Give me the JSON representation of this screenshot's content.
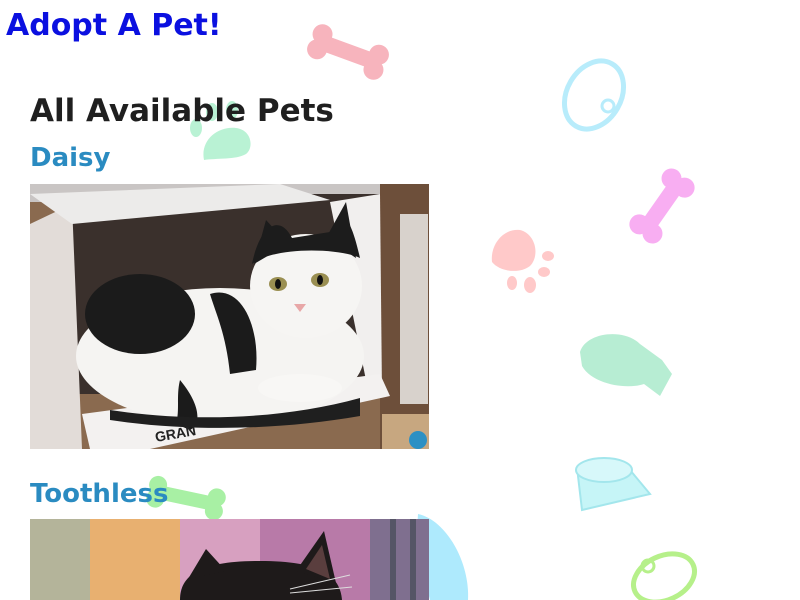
{
  "site": {
    "title": "Adopt A Pet!"
  },
  "main": {
    "heading": "All Available Pets"
  },
  "pets": [
    {
      "name": "Daisy"
    },
    {
      "name": "Toothless"
    }
  ],
  "colors": {
    "title": "#0b10e0",
    "heading": "#1f1f1f",
    "pet_name": "#2a8bc1"
  },
  "background_icons": [
    "bone-icon",
    "collar-icon",
    "paw-icon",
    "bone-icon",
    "paw-icon",
    "fish-icon",
    "bowl-icon",
    "bone-icon",
    "leaf-icon",
    "collar-icon"
  ]
}
